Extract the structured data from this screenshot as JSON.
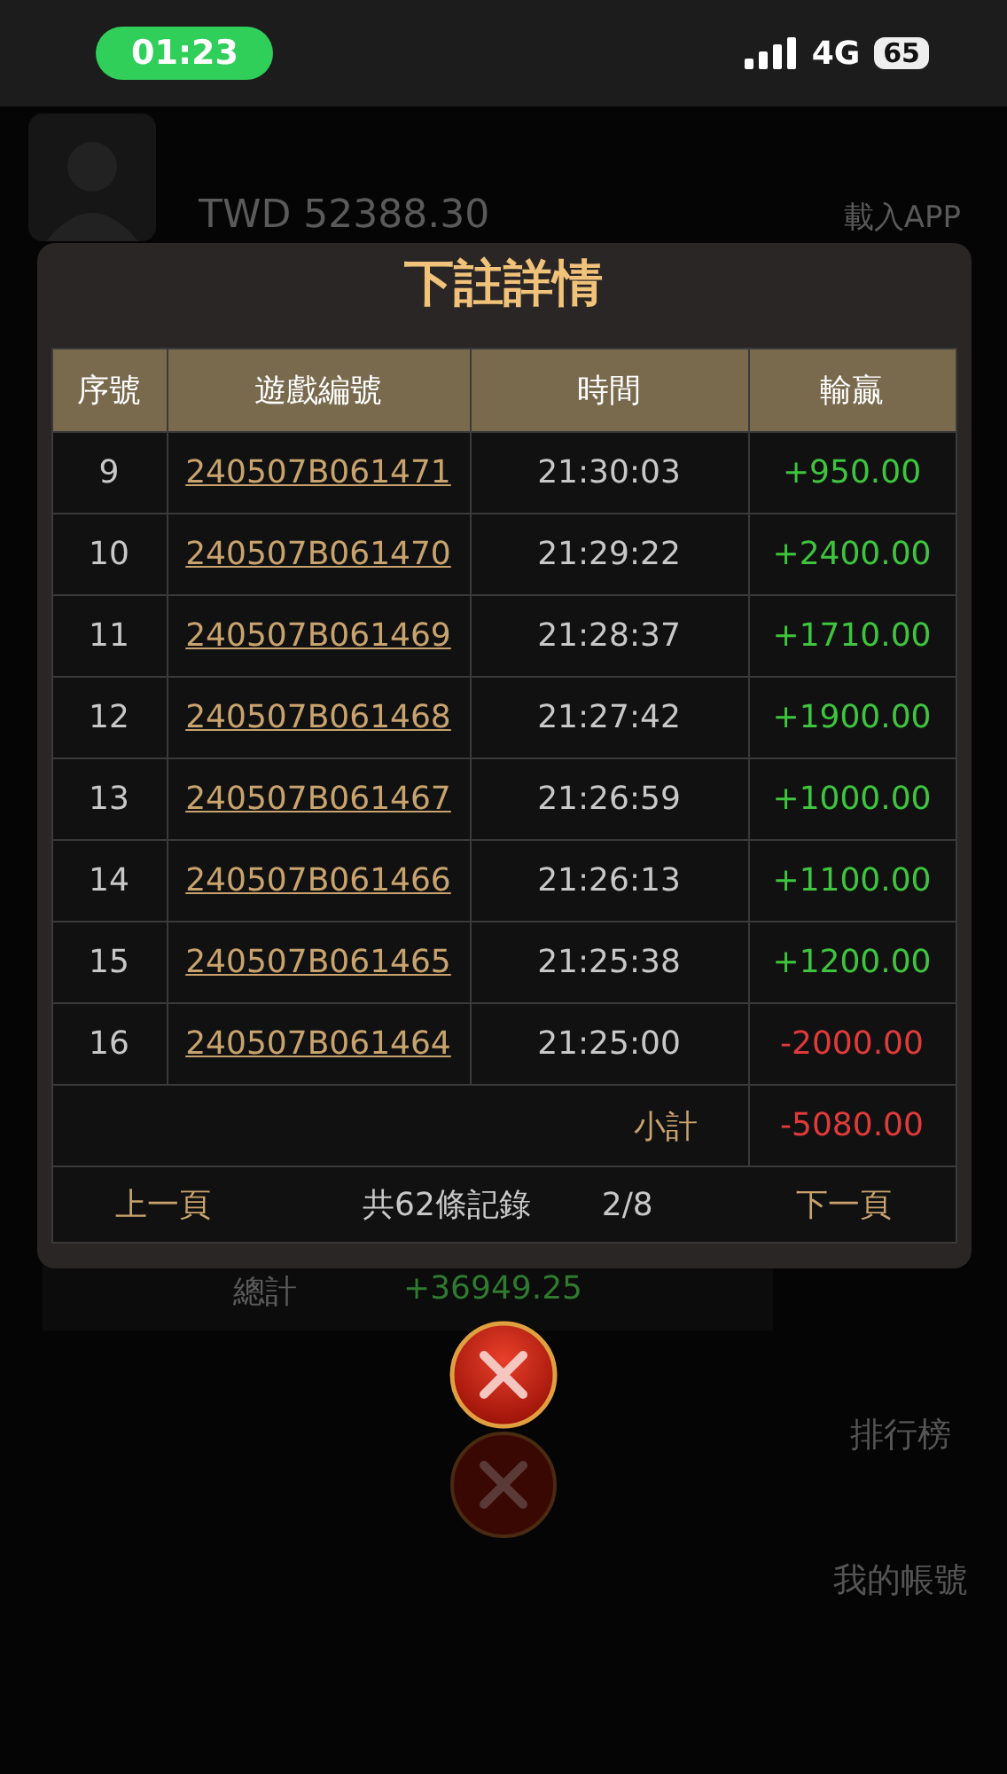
{
  "status_bar": {
    "time": "01:23",
    "network": "4G",
    "battery": "65"
  },
  "background": {
    "balance": "TWD 52388.30",
    "app_link": "載入APP",
    "total_label": "總計",
    "total_value": "+36949.25",
    "side_links": [
      "排行榜",
      "我的帳號"
    ]
  },
  "modal": {
    "title": "下註詳情",
    "columns": [
      "序號",
      "遊戲編號",
      "時間",
      "輸贏"
    ],
    "rows": [
      {
        "no": "9",
        "game_id": "240507B061471",
        "time": "21:30:03",
        "result": "+950.00",
        "negative": false
      },
      {
        "no": "10",
        "game_id": "240507B061470",
        "time": "21:29:22",
        "result": "+2400.00",
        "negative": false
      },
      {
        "no": "11",
        "game_id": "240507B061469",
        "time": "21:28:37",
        "result": "+1710.00",
        "negative": false
      },
      {
        "no": "12",
        "game_id": "240507B061468",
        "time": "21:27:42",
        "result": "+1900.00",
        "negative": false
      },
      {
        "no": "13",
        "game_id": "240507B061467",
        "time": "21:26:59",
        "result": "+1000.00",
        "negative": false
      },
      {
        "no": "14",
        "game_id": "240507B061466",
        "time": "21:26:13",
        "result": "+1100.00",
        "negative": false
      },
      {
        "no": "15",
        "game_id": "240507B061465",
        "time": "21:25:38",
        "result": "+1200.00",
        "negative": false
      },
      {
        "no": "16",
        "game_id": "240507B061464",
        "time": "21:25:00",
        "result": "-2000.00",
        "negative": true
      }
    ],
    "subtotal_label": "小計",
    "subtotal": "-5080.00",
    "subtotal_negative": true,
    "prev": "上一頁",
    "records": "共62條記錄",
    "page": "2/8",
    "next": "下一頁"
  }
}
